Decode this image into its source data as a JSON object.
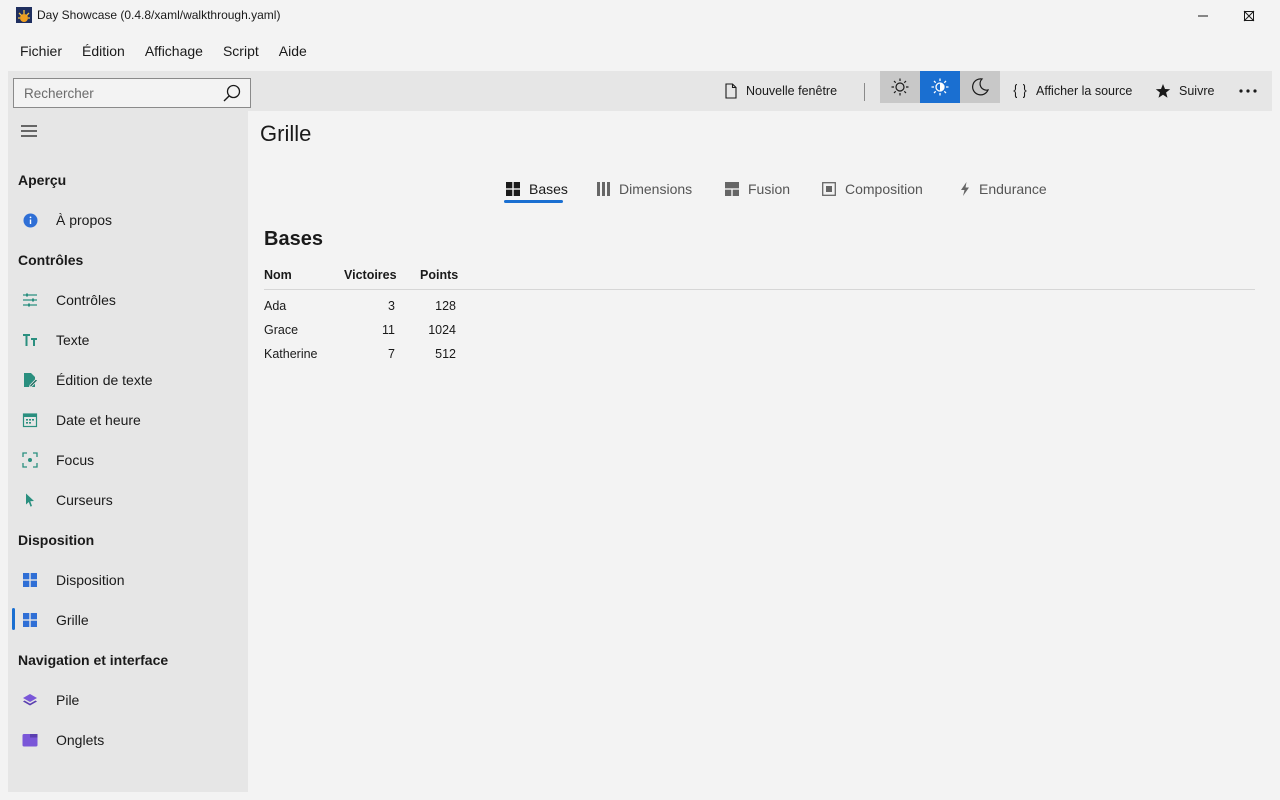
{
  "window": {
    "title": "Day Showcase (0.4.8/xaml/walkthrough.yaml)"
  },
  "menu": [
    "Fichier",
    "Édition",
    "Affichage",
    "Script",
    "Aide"
  ],
  "search": {
    "placeholder": "Rechercher"
  },
  "toolbar": {
    "new_window": "Nouvelle fenêtre",
    "view_source": "Afficher la source",
    "follow": "Suivre"
  },
  "sidebar": {
    "sections": [
      {
        "title": "Aperçu",
        "items": [
          {
            "label": "À propos",
            "icon": "info-icon"
          }
        ]
      },
      {
        "title": "Contrôles",
        "items": [
          {
            "label": "Contrôles",
            "icon": "sliders-icon"
          },
          {
            "label": "Texte",
            "icon": "text-icon"
          },
          {
            "label": "Édition de texte",
            "icon": "edit-document-icon"
          },
          {
            "label": "Date et heure",
            "icon": "calendar-icon"
          },
          {
            "label": "Focus",
            "icon": "focus-icon"
          },
          {
            "label": "Curseurs",
            "icon": "cursor-icon"
          }
        ]
      },
      {
        "title": "Disposition",
        "items": [
          {
            "label": "Disposition",
            "icon": "layout-icon"
          },
          {
            "label": "Grille",
            "icon": "grid-icon",
            "selected": true
          }
        ]
      },
      {
        "title": "Navigation et interface",
        "items": [
          {
            "label": "Pile",
            "icon": "stack-icon"
          },
          {
            "label": "Onglets",
            "icon": "tabs-icon"
          }
        ]
      }
    ]
  },
  "page": {
    "title": "Grille",
    "tabs": [
      {
        "label": "Bases",
        "icon": "grid-icon",
        "active": true
      },
      {
        "label": "Dimensions",
        "icon": "columns-icon"
      },
      {
        "label": "Fusion",
        "icon": "merge-icon"
      },
      {
        "label": "Composition",
        "icon": "composition-icon"
      },
      {
        "label": "Endurance",
        "icon": "lightning-icon"
      }
    ],
    "section_title": "Bases",
    "table": {
      "columns": [
        "Nom",
        "Victoires",
        "Points"
      ],
      "rows": [
        [
          "Ada",
          "3",
          "128"
        ],
        [
          "Grace",
          "11",
          "1024"
        ],
        [
          "Katherine",
          "7",
          "512"
        ]
      ]
    }
  },
  "colors": {
    "accent": "#1a6fd1",
    "icon_teal": "#2a8f7f",
    "icon_blue": "#2f6fd6",
    "icon_purple": "#7a57d8"
  }
}
